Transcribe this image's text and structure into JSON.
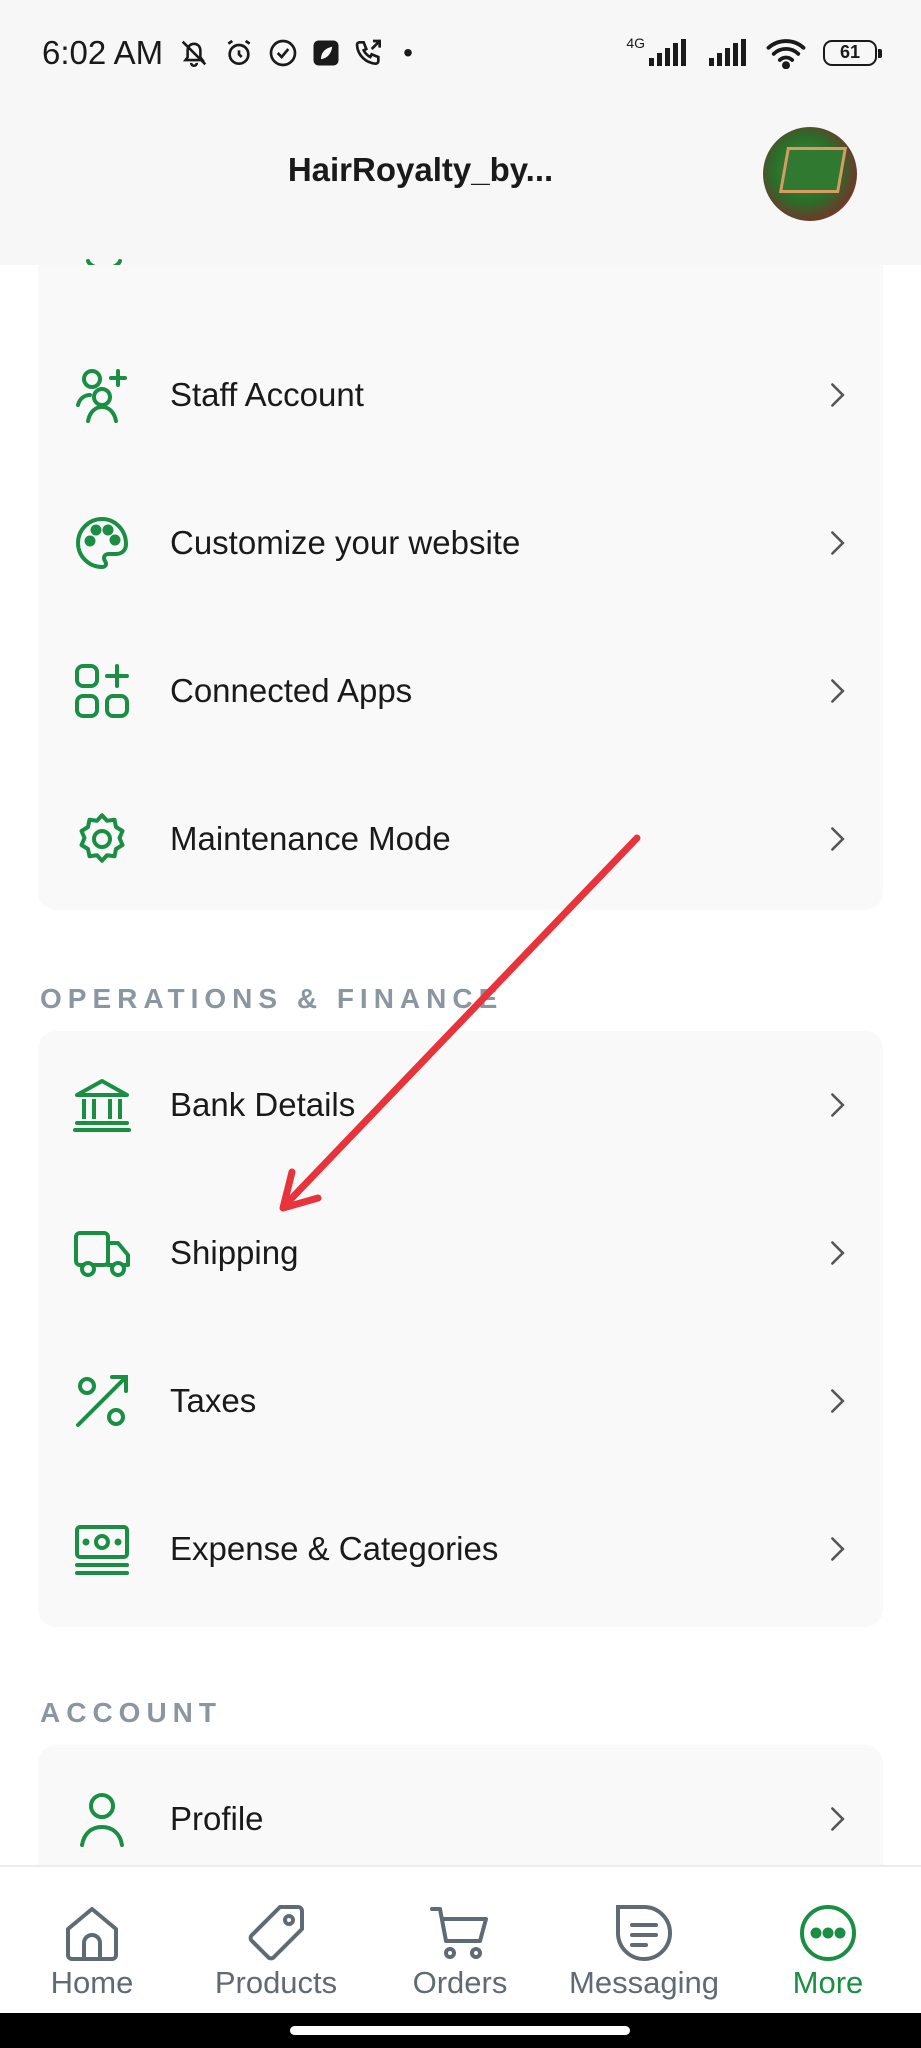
{
  "status_bar": {
    "time": "6:02 AM",
    "battery": "61",
    "network": "4G"
  },
  "header": {
    "title": "HairRoyalty_by..."
  },
  "sections": {
    "store": {
      "items": [
        {
          "label": "Staff Account",
          "icon": "staff-add-icon"
        },
        {
          "label": "Customize your website",
          "icon": "palette-icon"
        },
        {
          "label": "Connected Apps",
          "icon": "apps-add-icon"
        },
        {
          "label": "Maintenance Mode",
          "icon": "gear-icon"
        }
      ]
    },
    "operations": {
      "title": "OPERATIONS & FINANCE",
      "items": [
        {
          "label": "Bank Details",
          "icon": "bank-icon"
        },
        {
          "label": "Shipping",
          "icon": "truck-icon"
        },
        {
          "label": "Taxes",
          "icon": "percent-icon"
        },
        {
          "label": "Expense & Categories",
          "icon": "cash-icon"
        }
      ]
    },
    "account": {
      "title": "ACCOUNT",
      "items": [
        {
          "label": "Profile",
          "icon": "user-icon"
        }
      ]
    }
  },
  "bottom_nav": [
    {
      "label": "Home",
      "icon": "home-icon"
    },
    {
      "label": "Products",
      "icon": "tag-icon"
    },
    {
      "label": "Orders",
      "icon": "cart-icon"
    },
    {
      "label": "Messaging",
      "icon": "message-icon"
    },
    {
      "label": "More",
      "icon": "more-icon",
      "active": true
    }
  ],
  "colors": {
    "accent": "#1a8f44",
    "section_title": "#8a97a3",
    "annotation_arrow": "#e8333a"
  }
}
